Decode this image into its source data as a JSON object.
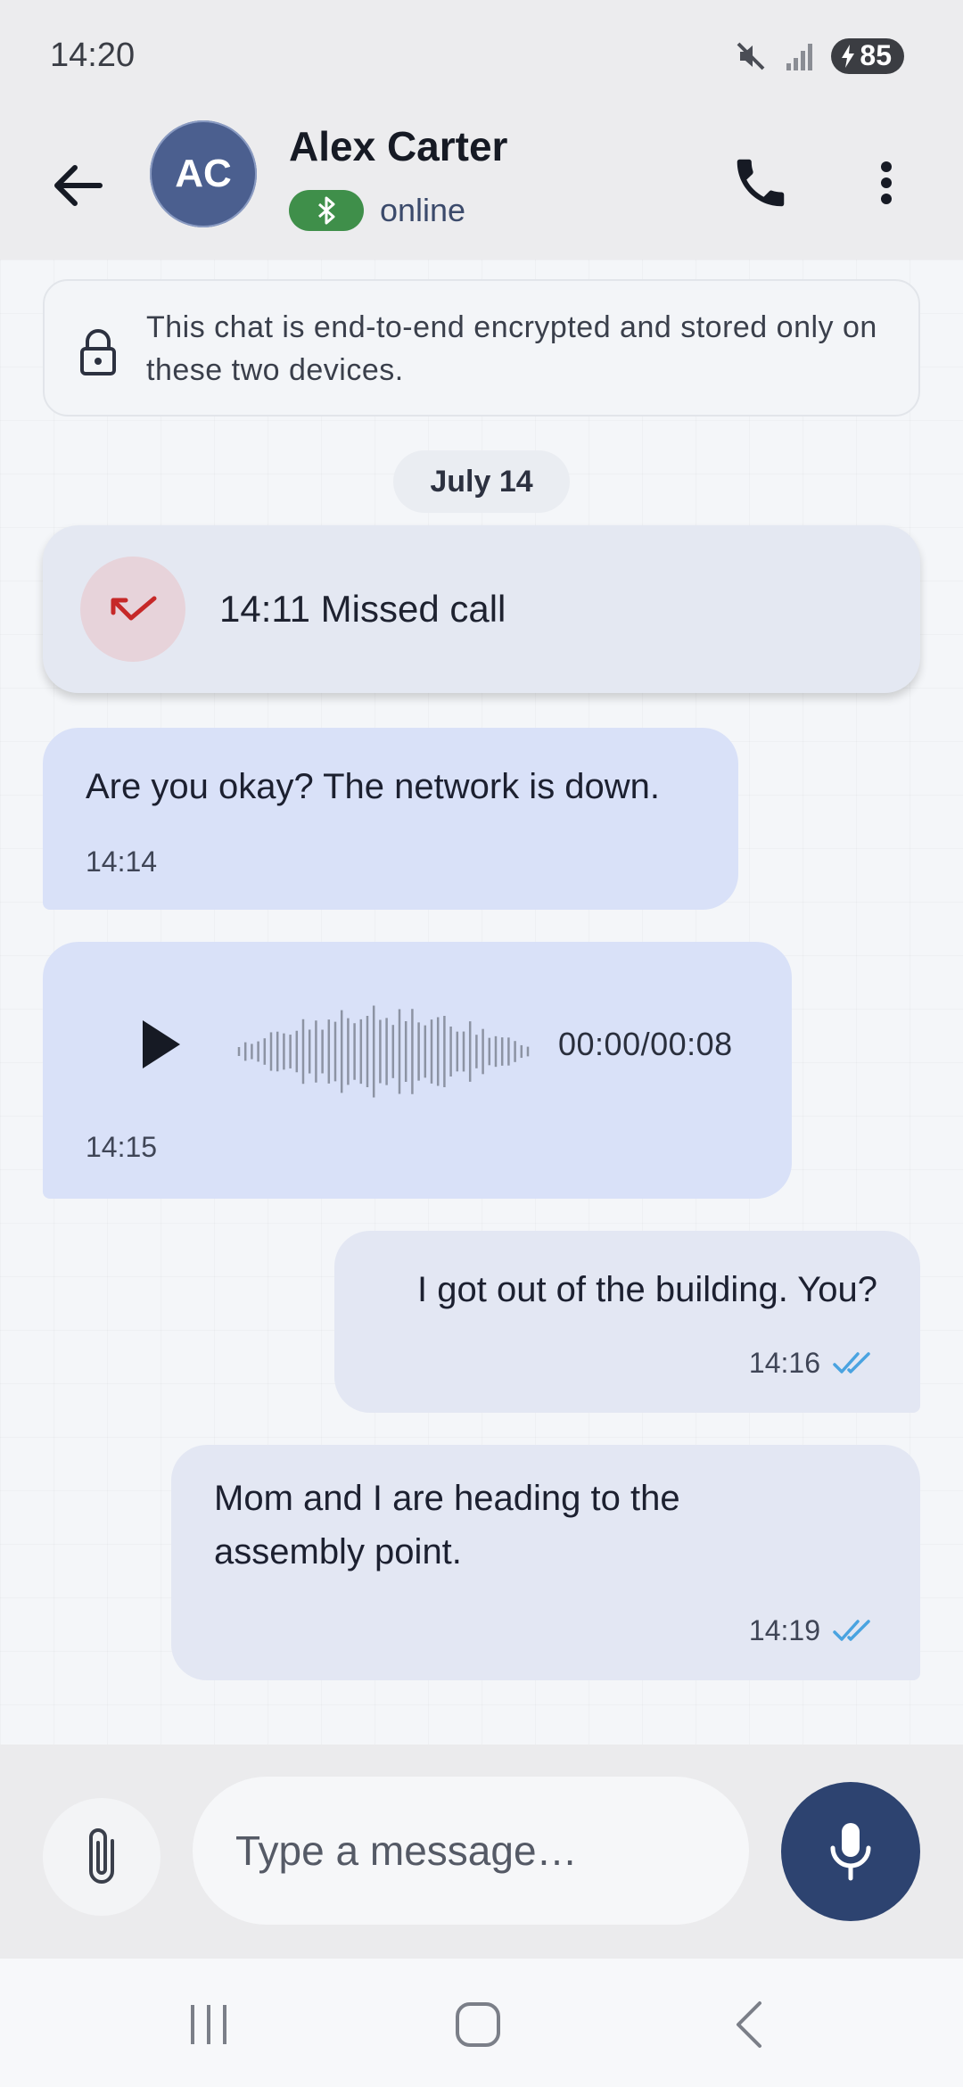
{
  "status_bar": {
    "time": "14:20",
    "battery_level": "85",
    "icons": [
      "mute-icon",
      "signal-icon",
      "battery-charging-icon"
    ]
  },
  "header": {
    "avatar_initials": "AC",
    "contact_name": "Alex Carter",
    "connection_icon": "bluetooth-icon",
    "presence": "online",
    "actions": [
      "back-arrow-icon",
      "phone-icon",
      "more-vertical-icon"
    ]
  },
  "chat": {
    "encryption_notice": "This chat is end-to-end encrypted and stored only on these two devices.",
    "date_divider": "July 14",
    "missed_call": {
      "label": "14:11 Missed call",
      "icon": "missed-call-icon"
    },
    "messages": [
      {
        "direction": "incoming",
        "text": "Are you okay? The network is down.",
        "time": "14:14"
      },
      {
        "direction": "incoming",
        "type": "voice",
        "duration": "00:00/00:08",
        "time": "14:15",
        "progress": 0
      },
      {
        "direction": "outgoing",
        "text": "I got out of the building. You?",
        "time": "14:16",
        "status": "read"
      },
      {
        "direction": "outgoing",
        "text": "Mom and I are heading to the assembly point.",
        "time": "14:19",
        "status": "read"
      }
    ]
  },
  "composer": {
    "placeholder": "Type a message…",
    "attach_icon": "paperclip-icon",
    "send_icon": "microphone-icon"
  },
  "nav_bar": {
    "buttons": [
      "recent-apps-icon",
      "home-icon",
      "back-icon"
    ]
  },
  "colors": {
    "accent": "#2d4370",
    "incoming_bubble": "#d9e1f8",
    "outgoing_bubble": "#e3e7f3",
    "missed_call": "#c62828",
    "read_ticks": "#4aa3e0",
    "online_badge": "#3f8f4a"
  }
}
